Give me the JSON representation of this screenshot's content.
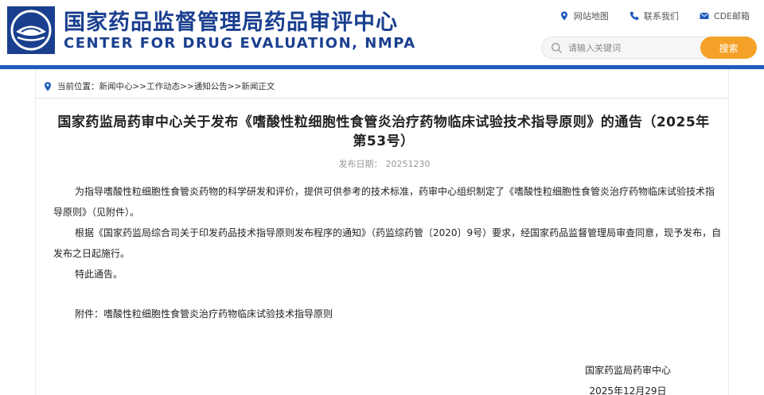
{
  "site": {
    "title_cn": "国家药品监督管理局药品审评中心",
    "title_en": "CENTER FOR DRUG EVALUATION, NMPA",
    "toplinks": [
      {
        "label": "网站地图",
        "icon": "map-pin-icon"
      },
      {
        "label": "联系我们",
        "icon": "phone-icon"
      },
      {
        "label": "CDE邮箱",
        "icon": "mail-icon"
      }
    ],
    "search": {
      "placeholder": "请输入关键词",
      "button_label": "搜索"
    },
    "colors": {
      "brand_blue": "#1a3f8f",
      "bar_blue": "#1e5bbd",
      "search_orange": "#f4a227"
    }
  },
  "breadcrumb": {
    "prefix": "当前位置：",
    "items": [
      "新闻中心",
      "工作动态",
      "通知公告",
      "新闻正文"
    ],
    "separator": ">>"
  },
  "article": {
    "title": "国家药监局药审中心关于发布《嗜酸性粒细胞性食管炎治疗药物临床试验技术指导原则》的通告（2025年第53号）",
    "date_label": "发布日期：",
    "date_value": "20251230",
    "paragraphs": [
      "为指导嗜酸性粒细胞性食管炎药物的科学研发和评价，提供可供参考的技术标准，药审中心组织制定了《嗜酸性粒细胞性食管炎治疗药物临床试验技术指导原则》（见附件）。",
      "根据《国家药监局综合司关于印发药品技术指导原则发布程序的通知》（药监综药管〔2020〕9号）要求，经国家药品监督管理局审查同意，现予发布，自发布之日起施行。",
      "特此通告。"
    ],
    "attachment": "附件：嗜酸性粒细胞性食管炎治疗药物临床试验技术指导原则",
    "signature_org": "国家药监局药审中心",
    "signature_date": "2025年12月29日"
  }
}
